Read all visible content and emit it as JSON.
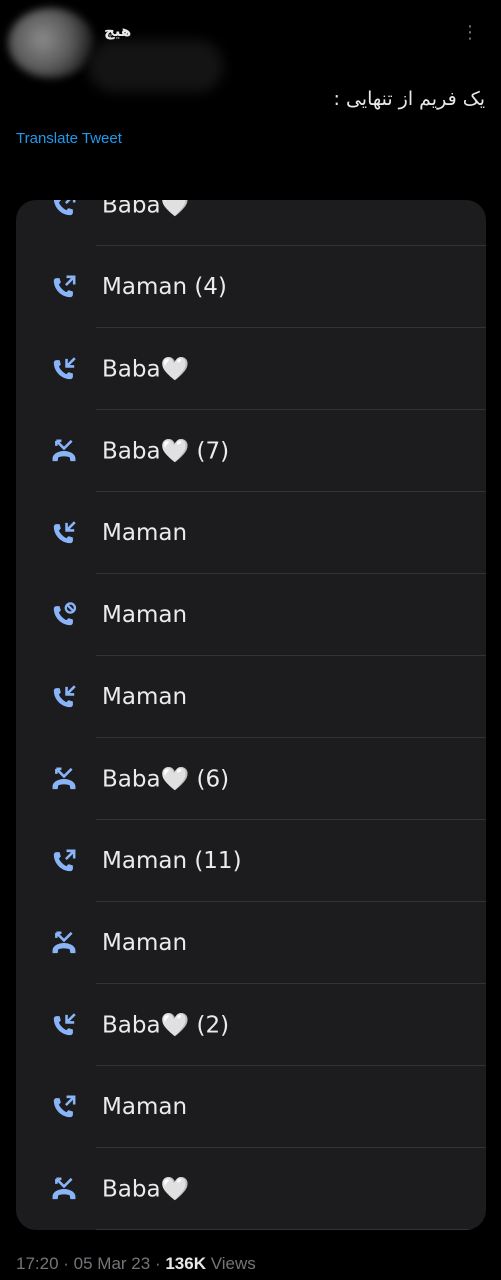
{
  "tweet": {
    "display_name": "هیچ",
    "text": "یک فریم از تنهایی :",
    "translate_label": "Translate Tweet",
    "more_glyph": "⋮"
  },
  "call_log": {
    "icon_color": "#8ab4f8",
    "missed_color": "#8ab4f8",
    "entries": [
      {
        "name": "Baba🤍",
        "type": "outgoing"
      },
      {
        "name": "Maman (4)",
        "type": "outgoing"
      },
      {
        "name": "Baba🤍",
        "type": "incoming"
      },
      {
        "name": "Baba🤍 (7)",
        "type": "missed"
      },
      {
        "name": "Maman",
        "type": "incoming"
      },
      {
        "name": "Maman",
        "type": "rejected"
      },
      {
        "name": "Maman",
        "type": "incoming"
      },
      {
        "name": "Baba🤍 (6)",
        "type": "missed"
      },
      {
        "name": "Maman (11)",
        "type": "outgoing"
      },
      {
        "name": "Maman",
        "type": "missed"
      },
      {
        "name": "Baba🤍 (2)",
        "type": "incoming"
      },
      {
        "name": "Maman",
        "type": "outgoing"
      },
      {
        "name": "Baba🤍",
        "type": "missed"
      }
    ]
  },
  "footer": {
    "time": "17:20",
    "date": "05 Mar 23",
    "views_count": "136K",
    "views_label": "Views"
  }
}
